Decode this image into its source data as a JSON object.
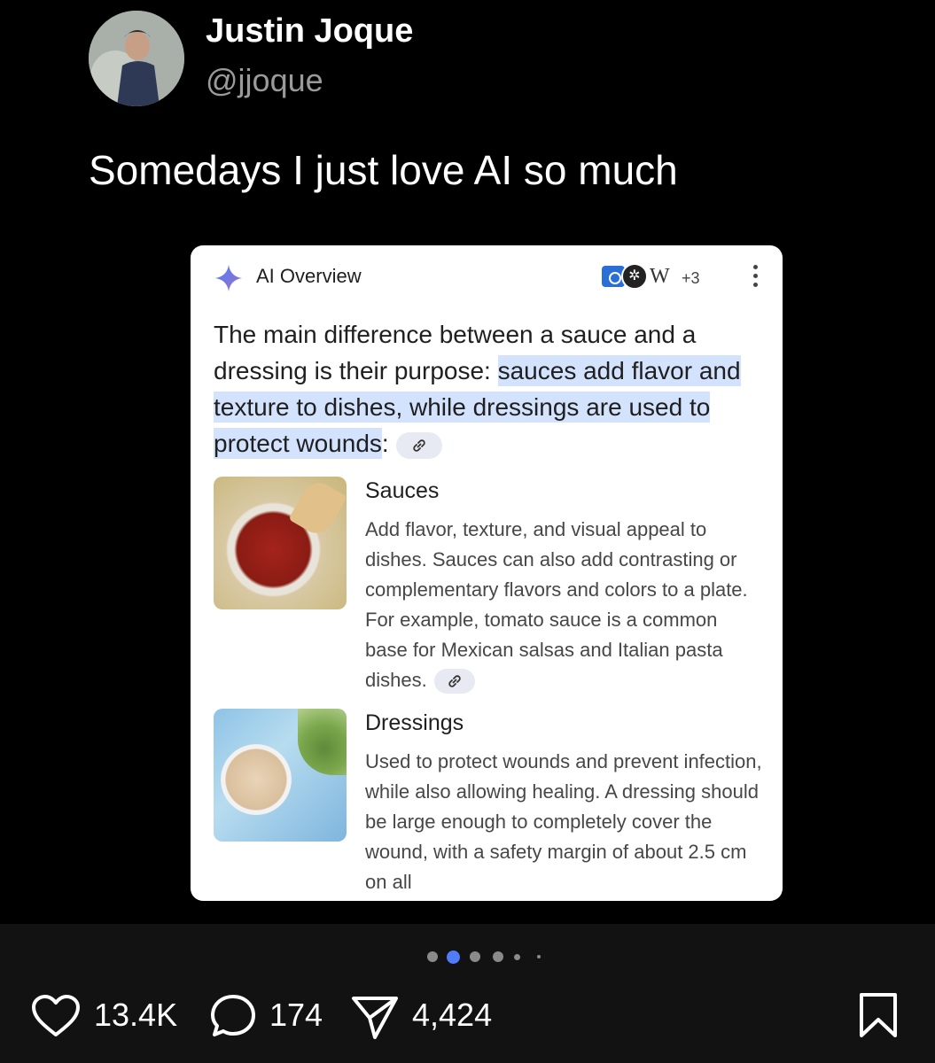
{
  "post": {
    "author_name": "Justin Joque",
    "author_handle": "@jjoque",
    "text": "Somedays I just love AI so much"
  },
  "ai_overview": {
    "title": "AI Overview",
    "source_more": "+3",
    "summary_plain": "The main difference between a sauce and a dressing is their purpose: ",
    "summary_highlight": "sauces add flavor and texture to dishes, while dressings are used to protect wounds",
    "summary_colon": ":",
    "items": [
      {
        "title": "Sauces",
        "body": "Add flavor, texture, and visual appeal to dishes. Sauces can also add contrasting or complementary flavors and colors to a plate. For example, tomato sauce is a common base for Mexican salsas and Italian pasta dishes."
      },
      {
        "title": "Dressings",
        "body": "Used to protect wounds and prevent infection, while also allowing healing. A dressing should be large enough to completely cover the wound, with a safety margin of about 2.5 cm on all"
      }
    ]
  },
  "carousel": {
    "count": 6,
    "active_index": 1
  },
  "actions": {
    "likes": "13.4K",
    "comments": "174",
    "shares": "4,424"
  },
  "colors": {
    "background": "#000000",
    "action_bar": "#121212",
    "highlight": "#d3e3fd",
    "accent": "#4f7cf7"
  }
}
